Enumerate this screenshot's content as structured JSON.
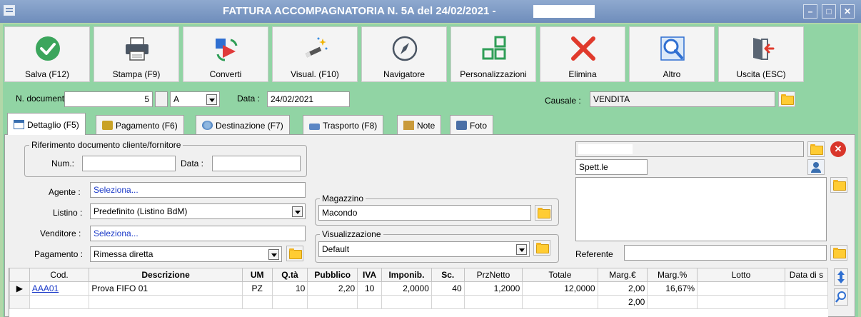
{
  "window": {
    "title": "FATTURA ACCOMPAGNATORIA N. 5A del 24/02/2021 -",
    "controls": {
      "minimize": "–",
      "maximize": "□",
      "close": "✕"
    }
  },
  "toolbar": {
    "buttons": [
      {
        "label": "Salva (F12)",
        "icon": "check-icon"
      },
      {
        "label": "Stampa (F9)",
        "icon": "printer-icon"
      },
      {
        "label": "Converti",
        "icon": "convert-icon"
      },
      {
        "label": "Visual. (F10)",
        "icon": "magic-wand-icon"
      },
      {
        "label": "Navigatore",
        "icon": "compass-icon"
      },
      {
        "label": "Personalizzazioni",
        "icon": "grid-squares-icon"
      },
      {
        "label": "Elimina",
        "icon": "red-x-icon"
      },
      {
        "label": "Altro",
        "icon": "magnifier-icon"
      },
      {
        "label": "Uscita (ESC)",
        "icon": "exit-door-icon"
      }
    ]
  },
  "header": {
    "doc_number_label": "N. documento :",
    "doc_number": "5",
    "series": "A",
    "date_label": "Data :",
    "date": "24/02/2021",
    "causale_label": "Causale :",
    "causale": "VENDITA"
  },
  "tabs": [
    {
      "label": "Dettaglio (F5)",
      "icon": "table-icon"
    },
    {
      "label": "Pagamento (F6)",
      "icon": "money-icon"
    },
    {
      "label": "Destinazione (F7)",
      "icon": "globe-icon"
    },
    {
      "label": "Trasporto (F8)",
      "icon": "truck-icon"
    },
    {
      "label": "Note",
      "icon": "note-icon"
    },
    {
      "label": "Foto",
      "icon": "camera-icon"
    }
  ],
  "riferimento": {
    "title": "Riferimento documento cliente/fornitore",
    "num_label": "Num.:",
    "num": "",
    "data_label": "Data :",
    "data": ""
  },
  "fields": {
    "agente_label": "Agente :",
    "agente": "Seleziona...",
    "listino_label": "Listino :",
    "listino": "Predefinito (Listino BdM)",
    "venditore_label": "Venditore :",
    "venditore": "Seleziona...",
    "pagamento_label": "Pagamento :",
    "pagamento": "Rimessa diretta"
  },
  "magazzino": {
    "title": "Magazzino",
    "value": "Macondo"
  },
  "visualizzazione": {
    "title": "Visualizzazione",
    "value": "Default"
  },
  "cliente": {
    "name": "",
    "title": "Spett.le",
    "address": "",
    "referente_label": "Referente",
    "referente": ""
  },
  "grid": {
    "columns": [
      "Cod.",
      "Descrizione",
      "UM",
      "Q.tà",
      "Pubblico",
      "IVA",
      "Imponib.",
      "Sc.",
      "PrzNetto",
      "Totale",
      "Marg.€",
      "Marg.%",
      "Lotto",
      "Data di s"
    ],
    "row": {
      "cod": "AAA01",
      "descrizione": "Prova FIFO 01",
      "um": "PZ",
      "qta": "10",
      "pubblico": "2,20",
      "iva": "10",
      "imponib": "2,0000",
      "sc": "40",
      "prznetto": "1,2000",
      "totale": "12,0000",
      "marg_eur": "2,00",
      "marg_pct": "16,67%",
      "lotto": "",
      "data_s": ""
    },
    "footer": {
      "marg_eur_total": "2,00"
    }
  }
}
